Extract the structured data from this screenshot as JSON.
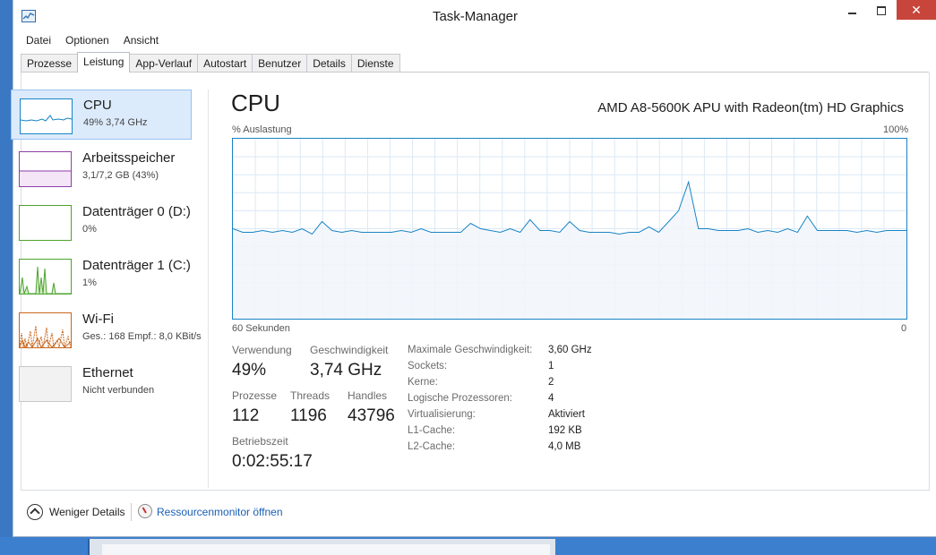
{
  "window": {
    "title": "Task-Manager"
  },
  "menu": [
    "Datei",
    "Optionen",
    "Ansicht"
  ],
  "tabs": [
    "Prozesse",
    "Leistung",
    "App-Verlauf",
    "Autostart",
    "Benutzer",
    "Details",
    "Dienste"
  ],
  "active_tab": "Leistung",
  "sidebar": {
    "items": [
      {
        "name": "CPU",
        "sub": "49% 3,74 GHz",
        "color": "#1783c4",
        "selected": true
      },
      {
        "name": "Arbeitsspeicher",
        "sub": "3,1/7,2 GB (43%)",
        "color": "#8e3ea8",
        "selected": false
      },
      {
        "name": "Datenträger 0 (D:)",
        "sub": "0%",
        "color": "#4da32e",
        "selected": false
      },
      {
        "name": "Datenträger 1 (C:)",
        "sub": "1%",
        "color": "#4da32e",
        "selected": false
      },
      {
        "name": "Wi-Fi",
        "sub": "Ges.: 168 Empf.: 8,0 KBit/s",
        "color": "#c7661c",
        "selected": false
      },
      {
        "name": "Ethernet",
        "sub": "Nicht verbunden",
        "color": "#a8a8a8",
        "selected": false
      }
    ]
  },
  "main": {
    "title": "CPU",
    "model": "AMD A8-5600K APU with Radeon(tm) HD Graphics",
    "graph": {
      "y_label": "% Auslastung",
      "y_max_label": "100%",
      "x_left_label": "60 Sekunden",
      "x_right_label": "0",
      "line_color": "#1783c4",
      "fill_color": "#f1f6fb"
    },
    "stats": {
      "usage_label": "Verwendung",
      "usage_value": "49%",
      "speed_label": "Geschwindigkeit",
      "speed_value": "3,74 GHz",
      "processes_label": "Prozesse",
      "processes_value": "112",
      "threads_label": "Threads",
      "threads_value": "1196",
      "handles_label": "Handles",
      "handles_value": "43796",
      "uptime_label": "Betriebszeit",
      "uptime_value": "0:02:55:17"
    },
    "details": [
      {
        "label": "Maximale Geschwindigkeit:",
        "value": "3,60 GHz"
      },
      {
        "label": "Sockets:",
        "value": "1"
      },
      {
        "label": "Kerne:",
        "value": "2"
      },
      {
        "label": "Logische Prozessoren:",
        "value": "4"
      },
      {
        "label": "Virtualisierung:",
        "value": "Aktiviert"
      },
      {
        "label": "L1-Cache:",
        "value": "192 KB"
      },
      {
        "label": "L2-Cache:",
        "value": "4,0 MB"
      }
    ]
  },
  "footer": {
    "less_details": "Weniger Details",
    "resource_monitor": "Ressourcenmonitor öffnen"
  },
  "chart_data": {
    "type": "line",
    "y_range": [
      0,
      100
    ],
    "values": [
      50,
      48,
      48,
      49,
      48,
      49,
      48,
      50,
      47,
      54,
      49,
      48,
      49,
      48,
      48,
      48,
      48,
      49,
      48,
      50,
      48,
      48,
      48,
      48,
      53,
      50,
      49,
      48,
      50,
      48,
      55,
      49,
      49,
      48,
      54,
      49,
      48,
      48,
      48,
      47,
      48,
      48,
      51,
      48,
      54,
      60,
      76,
      50,
      50,
      49,
      49,
      49,
      50,
      48,
      49,
      48,
      50,
      48,
      57,
      49,
      49,
      49,
      49,
      48,
      49,
      48,
      49,
      49,
      49
    ]
  }
}
